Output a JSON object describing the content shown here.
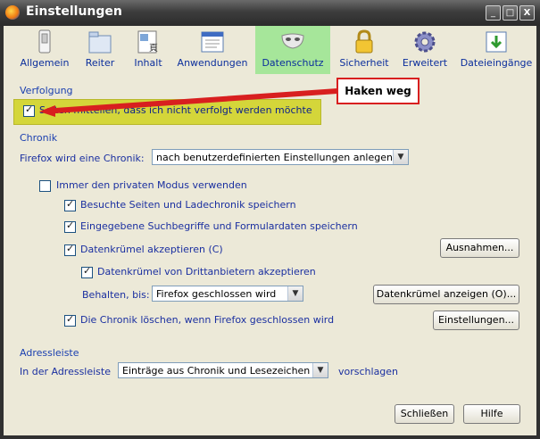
{
  "window": {
    "title": "Einstellungen"
  },
  "titlebar_buttons": {
    "minimize": "_",
    "maximize": "□",
    "close": "X"
  },
  "toolbar": {
    "items": [
      {
        "label": "Allgemein",
        "icon": "switch-icon"
      },
      {
        "label": "Reiter",
        "icon": "tabs-folder-icon"
      },
      {
        "label": "Inhalt",
        "icon": "content-page-icon"
      },
      {
        "label": "Anwendungen",
        "icon": "applications-window-icon"
      },
      {
        "label": "Datenschutz",
        "icon": "privacy-mask-icon",
        "active": true
      },
      {
        "label": "Sicherheit",
        "icon": "lock-icon"
      },
      {
        "label": "Erweitert",
        "icon": "gear-icon"
      },
      {
        "label": "Dateieingänge",
        "icon": "download-arrow-icon"
      }
    ]
  },
  "tracking": {
    "section": "Verfolgung",
    "dnt_label": "Seiten mitteilen, dass ich nicht verfolgt werden möchte",
    "dnt_checked": true
  },
  "annotation": {
    "callout_text": "Haken weg",
    "arrow_color": "#d81f1f",
    "highlight_color": "#d4d63a"
  },
  "history": {
    "section": "Chronik",
    "mode_label": "Firefox wird eine Chronik:",
    "mode_value": "nach benutzerdefinierten Einstellungen anlegen",
    "private_mode": "Immer den privaten Modus verwenden",
    "private_mode_checked": false,
    "visited": "Besuchte Seiten und Ladechronik speichern",
    "visited_checked": true,
    "search": "Eingegebene Suchbegriffe und Formulardaten speichern",
    "search_checked": true,
    "cookies": "Datenkrümel akzeptieren (C)",
    "cookies_checked": true,
    "exceptions_button": "Ausnahmen...",
    "third_party": "Datenkrümel von Drittanbietern akzeptieren",
    "third_party_checked": true,
    "keep_label": "Behalten, bis:",
    "keep_value": "Firefox geschlossen wird",
    "show_cookies_button": "Datenkrümel anzeigen (O)...",
    "clear_on_close": "Die Chronik löschen, wenn Firefox geschlossen wird",
    "clear_on_close_checked": true,
    "settings_button": "Einstellungen..."
  },
  "locationbar": {
    "section": "Adressleiste",
    "prefix": "In der Adressleiste",
    "value": "Einträge aus Chronik und Lesezeichen",
    "suffix": "vorschlagen"
  },
  "footer": {
    "close_button": "Schließen",
    "help_button": "Hilfe"
  }
}
